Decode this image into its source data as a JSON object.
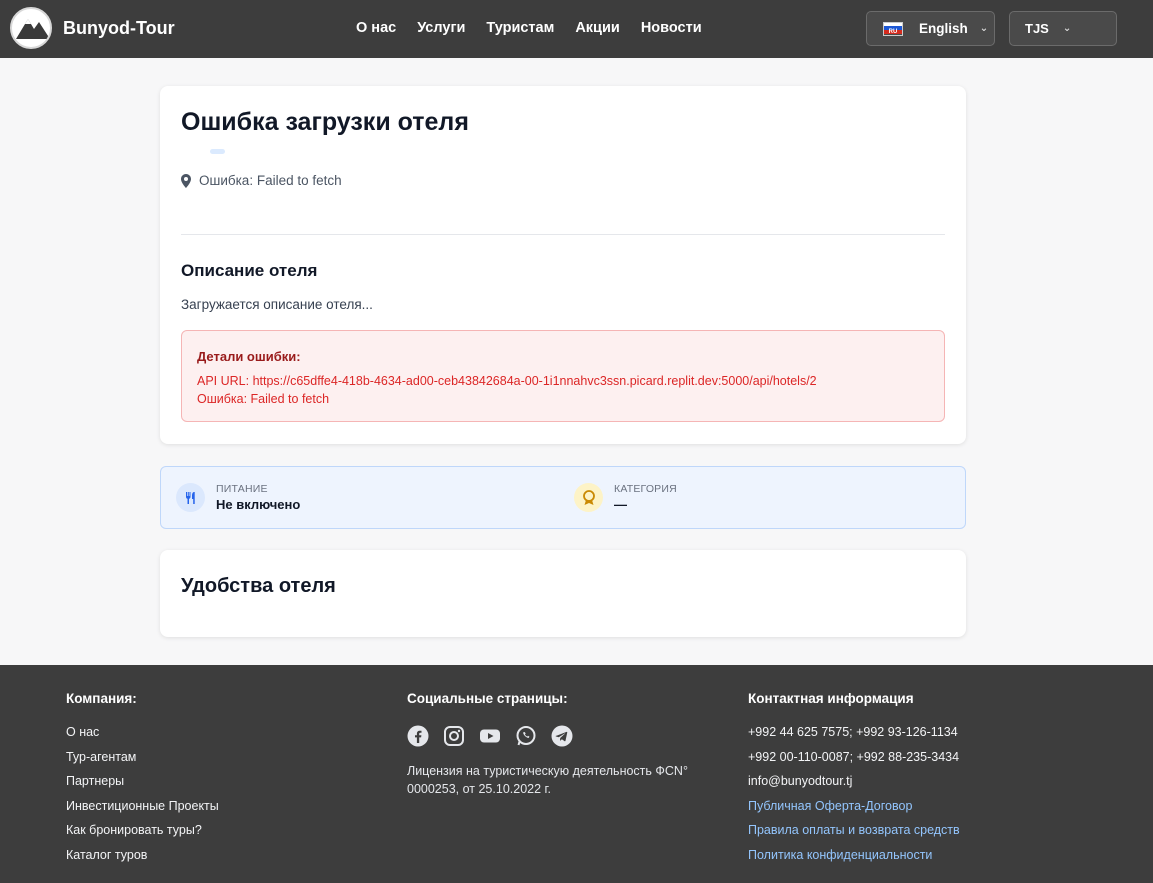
{
  "header": {
    "brand": "Bunyod-Tour",
    "nav": [
      "О нас",
      "Услуги",
      "Туристам",
      "Акции",
      "Новости"
    ],
    "language": {
      "flag_label": "RU",
      "label": "English"
    },
    "currency": "TJS"
  },
  "hotel": {
    "title": "Ошибка загрузки отеля",
    "location": "Ошибка: Failed to fetch",
    "description_title": "Описание отеля",
    "description_text": "Загружается описание отеля...",
    "error": {
      "title": "Детали ошибки:",
      "api_url": "API URL: https://c65dffe4-418b-4634-ad00-ceb43842684a-00-1i1nnahvc3ssn.picard.replit.dev:5000/api/hotels/2",
      "message": "Ошибка: Failed to fetch"
    }
  },
  "info": {
    "meal": {
      "label": "ПИТАНИЕ",
      "value": "Не включено",
      "icon": "utensils-icon"
    },
    "category": {
      "label": "КАТЕГОРИЯ",
      "value": "—",
      "icon": "award-icon"
    }
  },
  "amenities": {
    "title": "Удобства отеля"
  },
  "footer": {
    "company": {
      "title": "Компания:",
      "links": [
        "О нас",
        "Тур-агентам",
        "Партнеры",
        "Инвестиционные Проекты",
        "Как бронировать туры?",
        "Каталог туров"
      ]
    },
    "social": {
      "title": "Социальные страницы:",
      "icons": [
        "facebook-icon",
        "instagram-icon",
        "youtube-icon",
        "whatsapp-icon",
        "telegram-icon"
      ],
      "license": "Лицензия на туристическую деятельность ФСN° 0000253, от 25.10.2022 г."
    },
    "contact": {
      "title": "Контактная информация",
      "phones1": "+992 44 625 7575; +992 93-126-1134",
      "phones2": "+992 00-110-0087; +992 88-235-3434",
      "email": "info@bunyodtour.tj",
      "links": [
        "Публичная Оферта-Договор",
        "Правила оплаты и возврата средств",
        "Политика конфиденциальности"
      ]
    }
  }
}
